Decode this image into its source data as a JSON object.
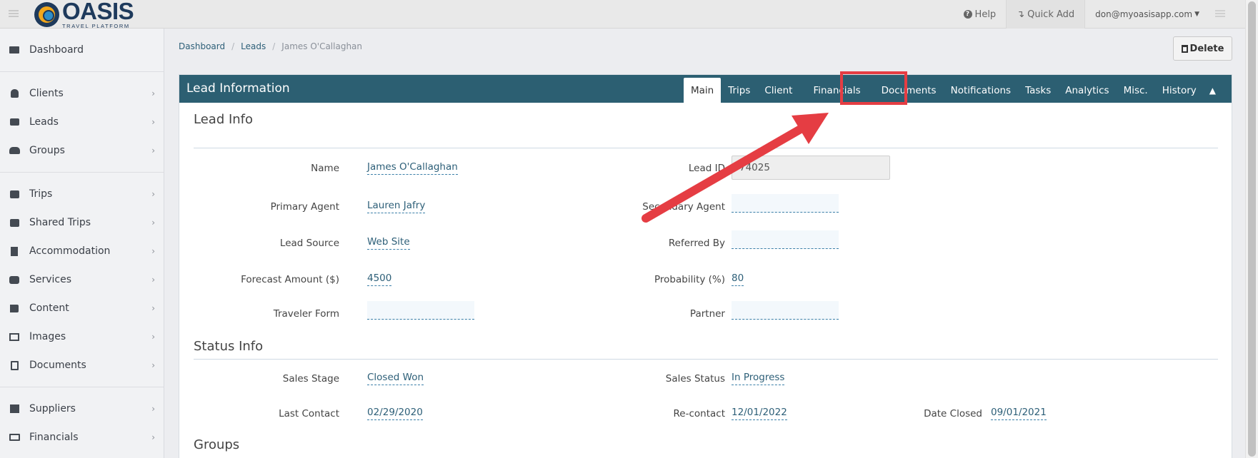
{
  "topbar": {
    "logo_name": "OASIS",
    "logo_subtitle": "TRAVEL PLATFORM",
    "help": "Help",
    "quick_add": "Quick Add",
    "user": "don@myoasisapp.com"
  },
  "sidebar": {
    "items": [
      {
        "label": "Dashboard",
        "icon": "monitor-icon"
      },
      {
        "label": "Clients",
        "icon": "user-icon"
      },
      {
        "label": "Leads",
        "icon": "inbox-icon"
      },
      {
        "label": "Groups",
        "icon": "users-icon"
      },
      {
        "label": "Trips",
        "icon": "briefcase-icon"
      },
      {
        "label": "Shared Trips",
        "icon": "briefcase-icon"
      },
      {
        "label": "Accommodation",
        "icon": "building-icon"
      },
      {
        "label": "Services",
        "icon": "binoculars-icon"
      },
      {
        "label": "Content",
        "icon": "flag-icon"
      },
      {
        "label": "Images",
        "icon": "image-icon"
      },
      {
        "label": "Documents",
        "icon": "file-icon"
      },
      {
        "label": "Suppliers",
        "icon": "box-icon"
      },
      {
        "label": "Financials",
        "icon": "money-icon"
      }
    ]
  },
  "breadcrumb": [
    "Dashboard",
    "Leads",
    "James O'Callaghan"
  ],
  "delete_label": "Delete",
  "panel": {
    "title": "Lead Information",
    "tabs": [
      "Main",
      "Trips",
      "Client",
      "Financials",
      "Documents",
      "Notifications",
      "Tasks",
      "Analytics",
      "Misc.",
      "History"
    ],
    "active_tab": "Main"
  },
  "lead_info": {
    "heading": "Lead Info",
    "name_label": "Name",
    "name": "James O'Callaghan",
    "lead_id_label": "Lead ID",
    "lead_id": "74025",
    "primary_agent_label": "Primary Agent",
    "primary_agent": "Lauren Jafry",
    "secondary_agent_label": "Secondary Agent",
    "lead_source_label": "Lead Source",
    "lead_source": "Web Site",
    "referred_by_label": "Referred By",
    "forecast_label": "Forecast Amount ($)",
    "forecast": "4500",
    "probability_label": "Probability (%)",
    "probability": "80",
    "traveler_form_label": "Traveler Form",
    "partner_label": "Partner"
  },
  "status_info": {
    "heading": "Status Info",
    "sales_stage_label": "Sales Stage",
    "sales_stage": "Closed Won",
    "sales_status_label": "Sales Status",
    "sales_status": "In Progress",
    "last_contact_label": "Last Contact",
    "last_contact": "02/29/2020",
    "recontact_label": "Re-contact",
    "recontact": "12/01/2022",
    "date_closed_label": "Date Closed",
    "date_closed": "09/01/2021"
  },
  "groups_heading": "Groups",
  "colors": {
    "panel_header": "#2c5f72",
    "link": "#2d5f78",
    "annotation": "#e53d43"
  }
}
